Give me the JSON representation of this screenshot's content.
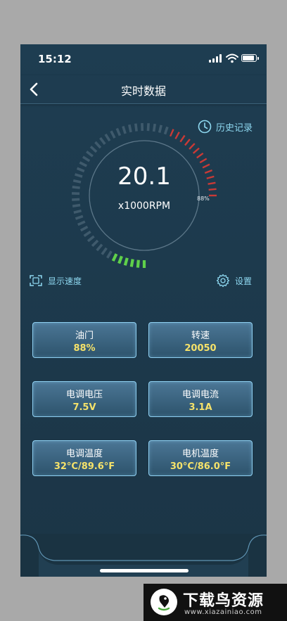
{
  "status_bar": {
    "time": "15:12"
  },
  "nav": {
    "title": "实时数据"
  },
  "history": {
    "label": "历史记录"
  },
  "gauge": {
    "value": "20.1",
    "unit": "x1000RPM",
    "percent_label": "88%",
    "throttle_fraction": 0.88
  },
  "links": {
    "speed_display": "显示速度",
    "settings": "设置"
  },
  "cards": [
    {
      "label": "油门",
      "value": "88%"
    },
    {
      "label": "转速",
      "value": "20050"
    },
    {
      "label": "电调电压",
      "value": "7.5V"
    },
    {
      "label": "电调电流",
      "value": "3.1A"
    },
    {
      "label": "电调温度",
      "value": "32°C/89.6°F"
    },
    {
      "label": "电机温度",
      "value": "30°C/86.0°F"
    }
  ],
  "watermark": {
    "title": "下载鸟资源",
    "url": "www.xiazainiao.com"
  },
  "colors": {
    "accent": "#8ed8f0",
    "value_yellow": "#f5e26a",
    "gauge_red": "#c93a36",
    "gauge_green": "#5fd04a"
  }
}
